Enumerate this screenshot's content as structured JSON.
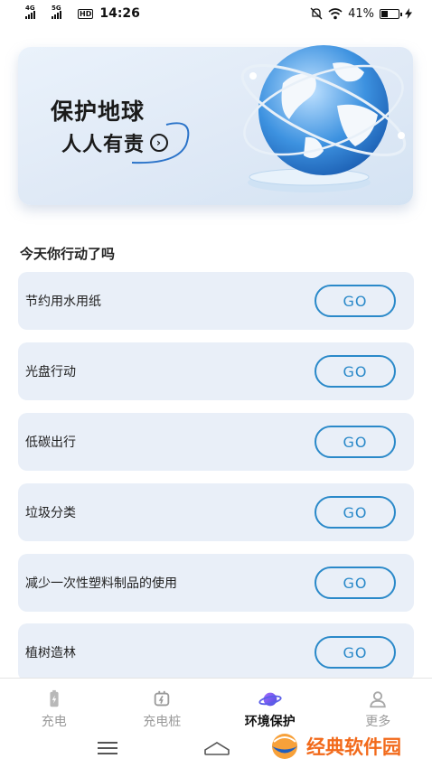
{
  "status_bar": {
    "net1": "4G",
    "net2": "5G",
    "hd": "HD",
    "time": "14:26",
    "battery": "41%",
    "battery_level": 0.41
  },
  "banner": {
    "title": "保护地球",
    "subtitle": "人人有责",
    "arrow": "›"
  },
  "section": {
    "title": "今天你行动了吗"
  },
  "actions": [
    {
      "label": "节约用水用纸",
      "button": "GO"
    },
    {
      "label": "光盘行动",
      "button": "GO"
    },
    {
      "label": "低碳出行",
      "button": "GO"
    },
    {
      "label": "垃圾分类",
      "button": "GO"
    },
    {
      "label": "减少一次性塑料制品的使用",
      "button": "GO"
    },
    {
      "label": "植树造林",
      "button": "GO"
    }
  ],
  "bottom_nav": [
    {
      "label": "充电",
      "icon": "battery-charge-icon",
      "active": false
    },
    {
      "label": "充电桩",
      "icon": "charging-pile-icon",
      "active": false
    },
    {
      "label": "环境保护",
      "icon": "planet-icon",
      "active": true
    },
    {
      "label": "更多",
      "icon": "user-icon",
      "active": false
    }
  ],
  "watermark": {
    "text": "经典软件园"
  },
  "colors": {
    "accent": "#2a89c9",
    "card_bg": "#e9eff8",
    "watermark": "#f26a1b"
  }
}
